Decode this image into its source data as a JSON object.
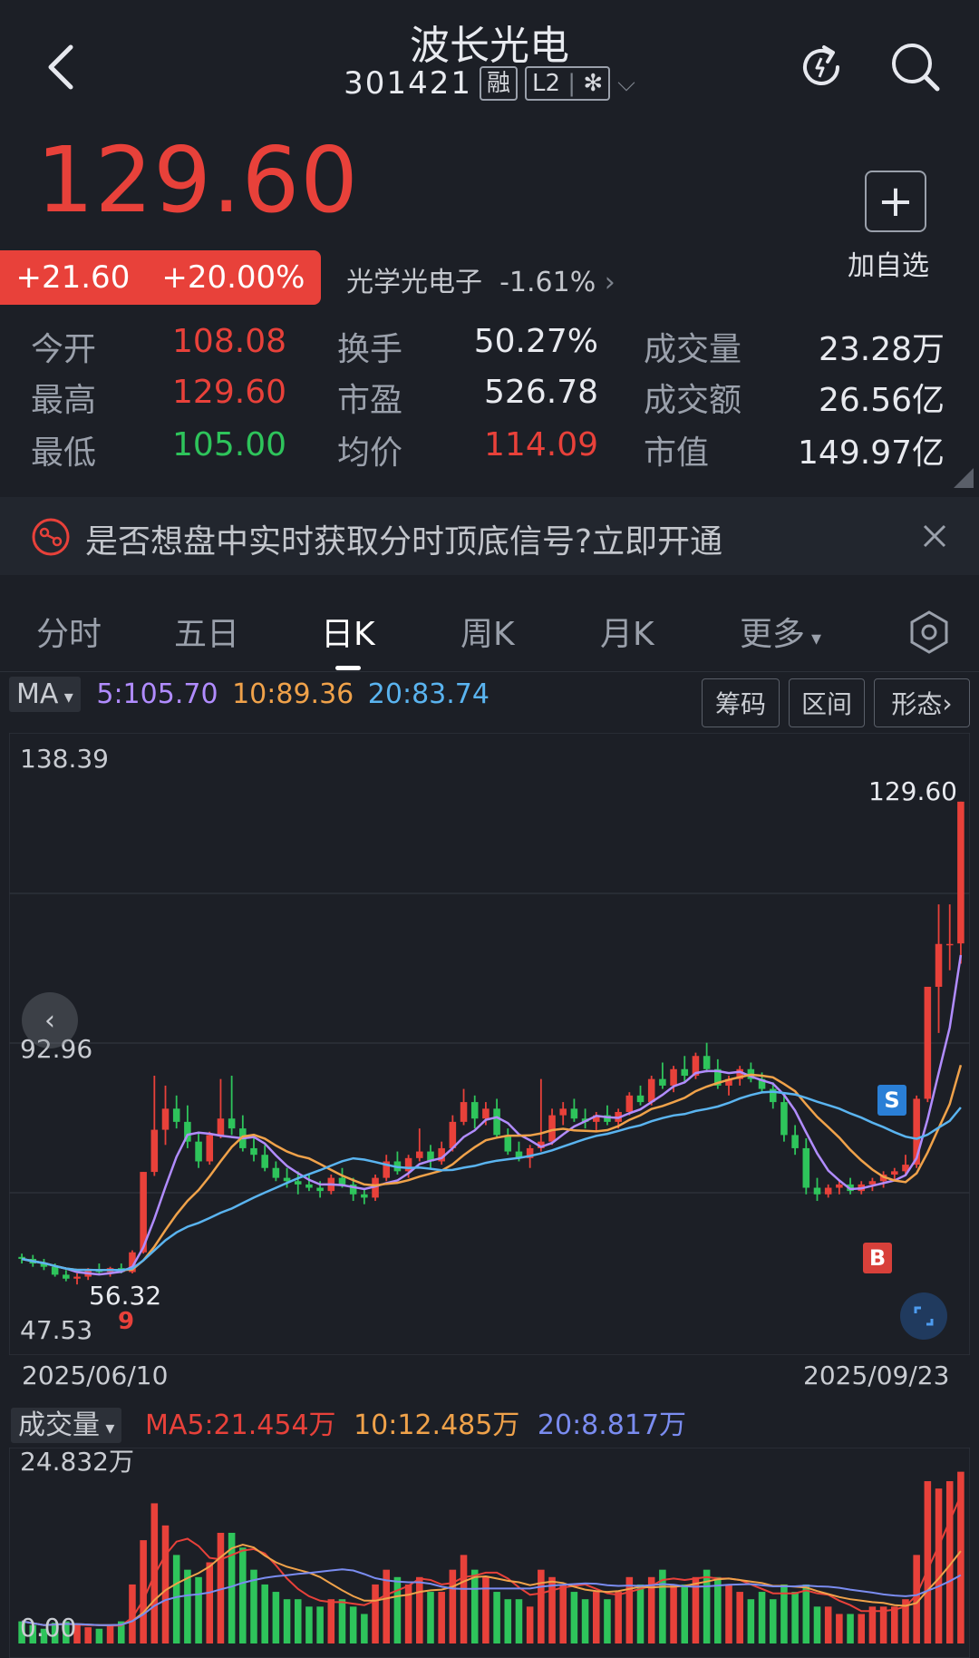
{
  "header": {
    "name": "波长光电",
    "code": "301421",
    "tag_margin": "融",
    "tag_l2": "L2",
    "tag_l2_suffix": "✻"
  },
  "quote": {
    "price": "129.60",
    "change": "+21.60",
    "change_pct": "+20.00%",
    "sector": "光学光电子",
    "sector_change": "-1.61%",
    "add_watch": "加自选"
  },
  "stats": [
    {
      "label": "今开",
      "value": "108.08",
      "color": "#e8413a"
    },
    {
      "label": "最高",
      "value": "129.60",
      "color": "#e8413a"
    },
    {
      "label": "最低",
      "value": "105.00",
      "color": "#2ec45b"
    },
    {
      "label": "换手",
      "value": "50.27%",
      "color": "#e8eaef"
    },
    {
      "label": "市盈",
      "value": "526.78",
      "color": "#e8eaef"
    },
    {
      "label": "均价",
      "value": "114.09",
      "color": "#e8413a"
    },
    {
      "label": "成交量",
      "value": "23.28万",
      "color": "#e8eaef"
    },
    {
      "label": "成交额",
      "value": "26.56亿",
      "color": "#e8eaef"
    },
    {
      "label": "市值",
      "value": "149.97亿",
      "color": "#e8eaef"
    }
  ],
  "banner": {
    "text": "是否想盘中实时获取分时顶底信号?立即开通"
  },
  "tabs": [
    "分时",
    "五日",
    "日K",
    "周K",
    "月K",
    "更多"
  ],
  "active_tab": "日K",
  "ma_legend": {
    "label": "MA",
    "ma5": "5:105.70",
    "ma10": "10:89.36",
    "ma20": "20:83.74",
    "color5": "#b18cff",
    "color10": "#f0a24a",
    "color20": "#5ab4f0"
  },
  "chart_buttons": [
    "筹码",
    "区间",
    "形态"
  ],
  "price_axis": {
    "top": "138.39",
    "mid": "92.96",
    "bottom": "47.53",
    "high_label": "129.60",
    "low_label": "56.32"
  },
  "dates": {
    "start": "2025/06/10",
    "end": "2025/09/23"
  },
  "volume": {
    "title": "成交量",
    "ma5": "MA5:21.454万",
    "ma10": "10:12.485万",
    "ma20": "20:8.817万",
    "max": "24.832万",
    "min": "0.00"
  },
  "markers": {
    "sell": "S",
    "buy": "B",
    "nine": "9"
  },
  "chart_data": {
    "type": "candlestick",
    "ylim": [
      47.53,
      138.39
    ],
    "candles": [
      [
        60.5,
        61.0,
        59.5,
        60.2
      ],
      [
        60.2,
        60.8,
        59.0,
        59.5
      ],
      [
        59.5,
        60.2,
        58.5,
        59.0
      ],
      [
        59.0,
        59.5,
        57.5,
        57.8
      ],
      [
        57.8,
        58.5,
        56.8,
        57.2
      ],
      [
        57.2,
        58.0,
        56.32,
        57.5
      ],
      [
        57.5,
        58.8,
        57.0,
        58.5
      ],
      [
        58.5,
        59.5,
        57.8,
        58.2
      ],
      [
        58.2,
        59.0,
        57.5,
        58.8
      ],
      [
        58.8,
        59.5,
        58.0,
        58.2
      ],
      [
        58.2,
        61.5,
        58.0,
        61.2
      ],
      [
        61.2,
        73.4,
        61.0,
        73.4
      ],
      [
        73.4,
        88.0,
        72.8,
        79.8
      ],
      [
        79.8,
        86.5,
        77.5,
        83.0
      ],
      [
        83.0,
        85.0,
        80.0,
        81.0
      ],
      [
        81.0,
        83.5,
        77.0,
        78.0
      ],
      [
        78.0,
        79.5,
        74.0,
        75.0
      ],
      [
        75.0,
        79.5,
        74.5,
        79.0
      ],
      [
        79.0,
        87.5,
        78.5,
        81.5
      ],
      [
        81.5,
        88.0,
        79.0,
        80.0
      ],
      [
        80.0,
        82.0,
        76.5,
        77.0
      ],
      [
        77.0,
        78.5,
        75.0,
        76.0
      ],
      [
        76.0,
        77.5,
        73.5,
        74.0
      ],
      [
        74.0,
        75.0,
        72.0,
        72.5
      ],
      [
        72.5,
        74.0,
        71.0,
        72.0
      ],
      [
        72.0,
        73.5,
        70.0,
        71.5
      ],
      [
        71.5,
        73.0,
        70.5,
        71.0
      ],
      [
        71.0,
        72.0,
        69.5,
        70.5
      ],
      [
        70.5,
        73.0,
        70.0,
        72.5
      ],
      [
        72.5,
        74.0,
        71.0,
        71.5
      ],
      [
        71.5,
        72.5,
        69.0,
        70.0
      ],
      [
        70.0,
        71.0,
        68.5,
        69.5
      ],
      [
        69.5,
        73.0,
        69.0,
        72.5
      ],
      [
        72.5,
        76.0,
        72.0,
        75.0
      ],
      [
        75.0,
        76.5,
        73.0,
        73.5
      ],
      [
        73.5,
        76.0,
        72.5,
        75.5
      ],
      [
        75.5,
        80.0,
        75.0,
        76.5
      ],
      [
        76.5,
        77.5,
        74.0,
        75.0
      ],
      [
        75.0,
        78.0,
        74.5,
        77.0
      ],
      [
        77.0,
        82.0,
        76.5,
        81.0
      ],
      [
        81.0,
        86.0,
        80.5,
        84.0
      ],
      [
        84.0,
        85.0,
        80.0,
        81.5
      ],
      [
        81.5,
        84.0,
        80.5,
        83.0
      ],
      [
        83.0,
        84.5,
        78.5,
        79.0
      ],
      [
        79.0,
        80.0,
        76.0,
        76.5
      ],
      [
        76.5,
        78.0,
        75.0,
        75.5
      ],
      [
        75.5,
        77.5,
        74.0,
        77.0
      ],
      [
        77.0,
        87.5,
        76.5,
        78.0
      ],
      [
        78.0,
        83.0,
        77.5,
        82.0
      ],
      [
        82.0,
        84.0,
        80.5,
        83.0
      ],
      [
        83.0,
        84.5,
        81.0,
        81.5
      ],
      [
        81.5,
        83.0,
        80.0,
        81.0
      ],
      [
        81.0,
        82.5,
        79.5,
        82.0
      ],
      [
        82.0,
        83.5,
        80.5,
        81.0
      ],
      [
        81.0,
        83.0,
        80.0,
        82.5
      ],
      [
        82.5,
        85.5,
        82.0,
        85.0
      ],
      [
        85.0,
        86.5,
        83.5,
        84.0
      ],
      [
        84.0,
        88.0,
        83.5,
        87.5
      ],
      [
        87.5,
        90.0,
        86.0,
        86.5
      ],
      [
        86.5,
        89.5,
        85.5,
        89.0
      ],
      [
        89.0,
        91.0,
        87.0,
        88.0
      ],
      [
        88.0,
        91.5,
        87.5,
        91.0
      ],
      [
        91.0,
        93.0,
        88.5,
        89.0
      ],
      [
        89.0,
        90.5,
        86.0,
        86.5
      ],
      [
        86.5,
        88.0,
        85.0,
        87.5
      ],
      [
        87.5,
        89.5,
        86.5,
        89.0
      ],
      [
        89.0,
        90.0,
        87.0,
        87.5
      ],
      [
        87.5,
        88.5,
        85.5,
        86.0
      ],
      [
        86.0,
        87.0,
        83.0,
        84.0
      ],
      [
        84.0,
        85.0,
        78.0,
        79.0
      ],
      [
        79.0,
        80.5,
        76.0,
        77.0
      ],
      [
        77.0,
        78.5,
        70.0,
        71.0
      ],
      [
        71.0,
        72.5,
        69.0,
        70.0
      ],
      [
        70.0,
        71.5,
        69.5,
        71.0
      ],
      [
        71.0,
        72.0,
        70.0,
        71.5
      ],
      [
        71.5,
        72.5,
        70.0,
        70.5
      ],
      [
        70.5,
        72.0,
        70.0,
        71.5
      ],
      [
        71.5,
        72.5,
        70.5,
        72.0
      ],
      [
        72.0,
        73.5,
        71.0,
        73.0
      ],
      [
        73.0,
        74.0,
        72.0,
        73.5
      ],
      [
        73.5,
        76.0,
        73.0,
        74.5
      ],
      [
        74.5,
        85.0,
        74.0,
        84.5
      ],
      [
        84.5,
        101.5,
        84.0,
        101.5
      ],
      [
        101.5,
        114.0,
        94.5,
        108.0
      ],
      [
        108.0,
        114.0,
        104.0,
        108.0
      ],
      [
        108.08,
        129.6,
        105.0,
        129.6
      ]
    ],
    "volume_max": 24.832,
    "volumes": [
      3,
      2.5,
      2,
      2.8,
      3,
      2.5,
      2.2,
      2,
      2.4,
      3,
      8,
      14,
      19,
      16,
      12,
      10,
      9,
      11,
      15,
      15,
      13,
      10,
      8,
      7,
      6,
      6,
      5,
      5,
      6,
      6,
      5,
      4,
      8,
      10,
      9,
      8,
      9,
      7,
      7,
      10,
      12,
      10,
      9,
      7,
      6,
      6,
      5,
      10,
      9,
      8,
      7,
      6,
      7,
      6,
      7,
      9,
      8,
      9,
      10,
      8,
      8,
      9,
      10,
      9,
      8,
      7,
      6,
      7,
      6,
      8,
      7,
      8,
      5,
      5,
      4,
      4,
      4,
      5,
      5,
      5,
      6,
      12,
      22,
      21,
      22,
      23.28
    ]
  }
}
